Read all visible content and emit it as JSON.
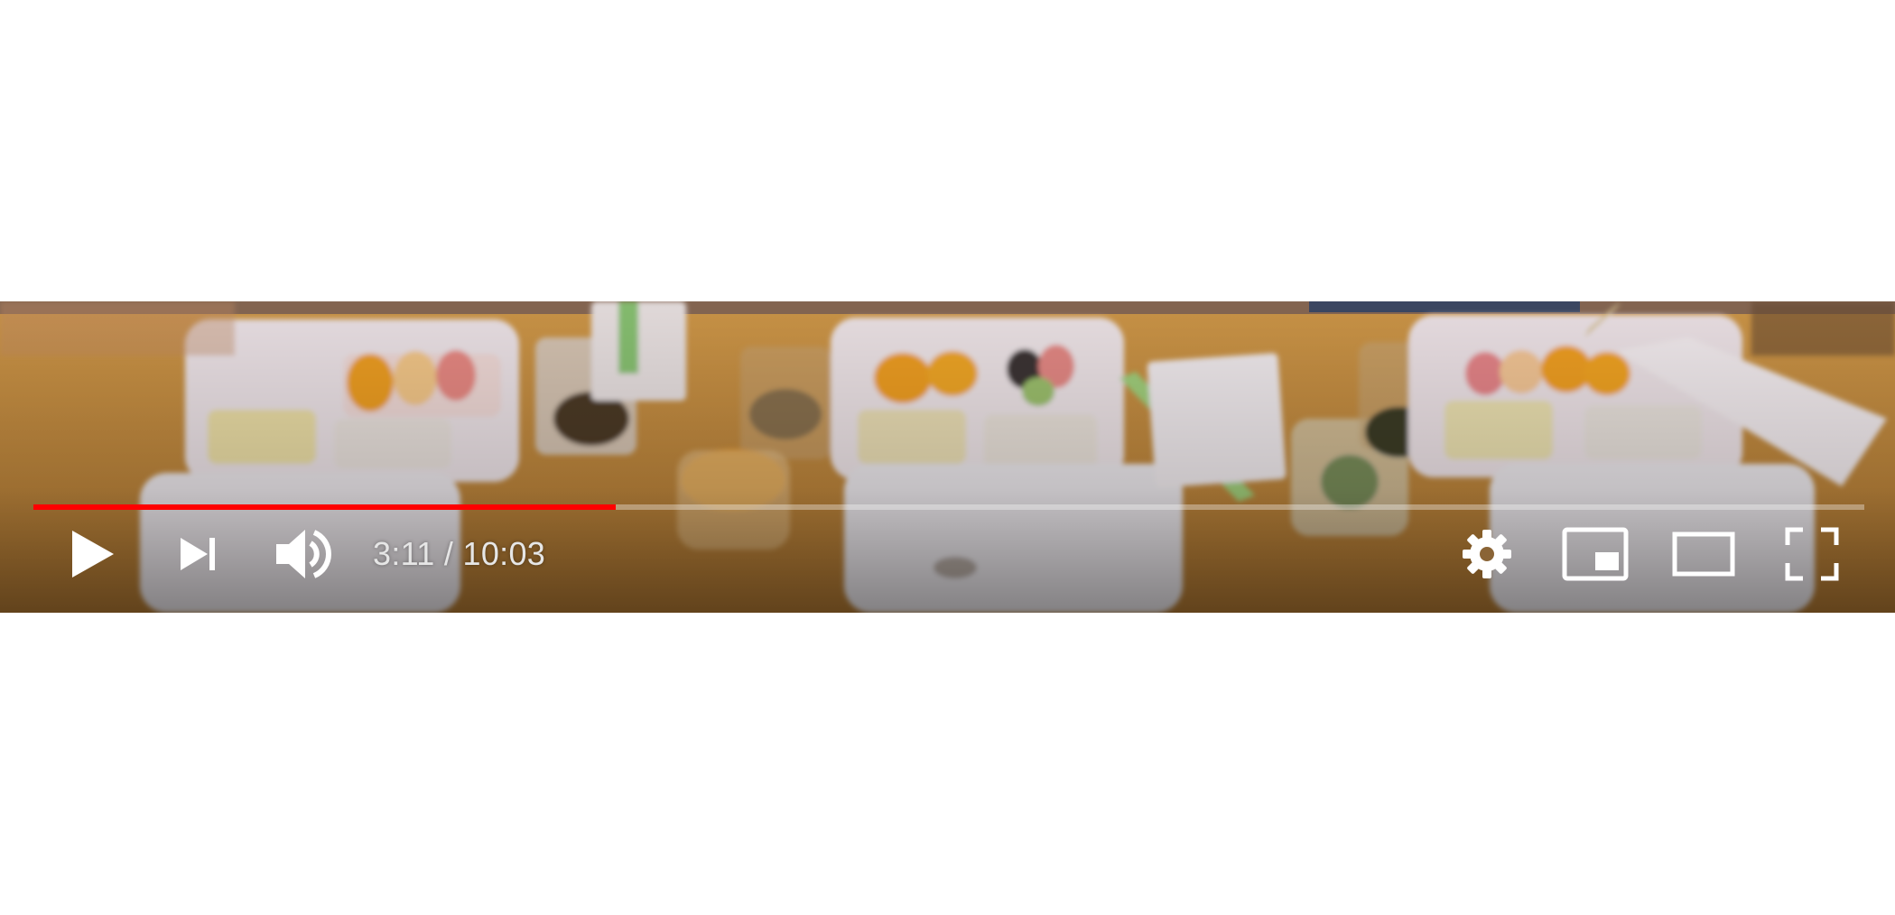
{
  "player": {
    "time_current": "3:11",
    "time_separator": " / ",
    "time_total": "10:03",
    "progress_played_fraction": 0.318,
    "progress_buffered_fraction": 0.318,
    "colors": {
      "progress_played": "#ff0000",
      "controls": "#ffffff"
    },
    "icons": {
      "play": "play-icon",
      "next": "next-icon",
      "volume": "volume-icon",
      "settings": "gear-icon",
      "miniplayer": "miniplayer-icon",
      "theater": "theater-icon",
      "fullscreen": "fullscreen-icon"
    }
  }
}
